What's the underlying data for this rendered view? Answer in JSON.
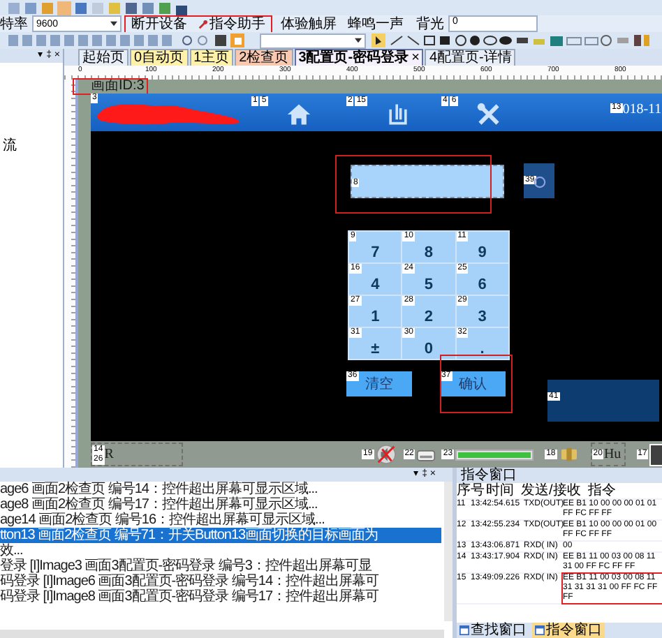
{
  "toolbar": {
    "baud_label": "特率",
    "baud": "9600",
    "groups": [
      {
        "annotated": true,
        "buttons": [
          {
            "label": "断开设备",
            "kind": "plain"
          },
          {
            "label": "指令助手",
            "kind": "tool"
          }
        ]
      },
      {
        "annotated": false,
        "buttons": [
          {
            "label": "体验触屏",
            "kind": "plain"
          },
          {
            "label": "蜂鸣一声",
            "kind": "plain"
          }
        ]
      }
    ],
    "backlight_label": "背光",
    "backlight": "0"
  },
  "side_panel": {
    "controls": "▾ ‡ ×",
    "item": "流"
  },
  "editor": {
    "tabs": [
      {
        "label": "起始页",
        "selected": false,
        "color": "#e8eef8"
      },
      {
        "label": "0自动页",
        "selected": false,
        "color": "#fff2a8"
      },
      {
        "label": "1主页",
        "selected": false,
        "color": "#fff2a8"
      },
      {
        "label": "2检查页",
        "selected": false,
        "color": "#f8c8b0"
      },
      {
        "label": "3配置页-密码登录",
        "selected": true,
        "color": "#f4f0fc",
        "close": "×"
      },
      {
        "label": "4配置页-详情",
        "selected": false,
        "color": "#e8eef8"
      }
    ],
    "ruler": [
      "0",
      "100",
      "200",
      "300",
      "400",
      "500",
      "600",
      "700",
      "800"
    ],
    "screen": {
      "id_label": "画面ID:3",
      "annotated": true,
      "header": {
        "logo_id": "3",
        "nav": [
          {
            "ids": [
              "1",
              "5"
            ],
            "kind": "home"
          },
          {
            "ids": [
              "2",
              "15"
            ],
            "kind": "tower"
          },
          {
            "ids": [
              "4",
              "6"
            ],
            "kind": "tools"
          }
        ],
        "clock_id": "13",
        "clock": "018-11"
      },
      "input": {
        "id": "8",
        "annotated": true
      },
      "icon_tile": {
        "id": "39"
      },
      "keypad": [
        {
          "id": "9",
          "label": "7"
        },
        {
          "id": "10",
          "label": "8"
        },
        {
          "id": "11",
          "label": "9"
        },
        {
          "id": "16",
          "label": "4"
        },
        {
          "id": "24",
          "label": "5"
        },
        {
          "id": "25",
          "label": "6"
        },
        {
          "id": "27",
          "label": "1"
        },
        {
          "id": "28",
          "label": "2"
        },
        {
          "id": "29",
          "label": "3"
        },
        {
          "id": "31",
          "label": "±"
        },
        {
          "id": "30",
          "label": "0"
        },
        {
          "id": "32",
          "label": "."
        }
      ],
      "buttons": [
        {
          "id": "36",
          "label": "清空",
          "annotated": false
        },
        {
          "id": "37",
          "label": "确认",
          "annotated": true
        }
      ],
      "panel": {
        "id": "41"
      },
      "strip": [
        {
          "kind": "text",
          "ids": [
            "14",
            "26"
          ],
          "text": "R"
        },
        {
          "kind": "mute",
          "ids": [
            "19"
          ]
        },
        {
          "kind": "disk",
          "ids": [
            "22"
          ]
        },
        {
          "kind": "bar",
          "ids": [
            "23"
          ],
          "level": 1
        },
        {
          "kind": "plug",
          "ids": [
            "18"
          ]
        },
        {
          "kind": "text",
          "ids": [
            "20"
          ],
          "text": "Hu"
        },
        {
          "kind": "box",
          "ids": [
            "17"
          ]
        }
      ]
    }
  },
  "output_panel": {
    "controls": "▾ ‡ ×",
    "lines": [
      {
        "text": "age6 画面2检查页 编号14：控件超出屏幕可显示区域...",
        "selected": false
      },
      {
        "text": "age8 画面2检查页 编号17：控件超出屏幕可显示区域...",
        "selected": false
      },
      {
        "text": "age14 画面2检查页 编号16：控件超出屏幕可显示区域...",
        "selected": false
      },
      {
        "text": "tton13 画面2检查页 编号71：开关Button13画面切换的目标画面为",
        "selected": true
      },
      {
        "text": "效...",
        "selected": false
      },
      {
        "text": "登录 [I]Image3 画面3配置页-密码登录 编号3：控件超出屏幕可显",
        "selected": false
      },
      {
        "text": "码登录 [I]Image6 画面3配置页-密码登录 编号14：控件超出屏幕可",
        "selected": false
      },
      {
        "text": "码登录 [I]Image8 画面3配置页-密码登录 编号17：控件超出屏幕可",
        "selected": false
      }
    ]
  },
  "command_window": {
    "title": "指令窗口",
    "columns": [
      "序号",
      "时间",
      "发送/接收",
      "指令"
    ],
    "rows": [
      {
        "cells": [
          "11",
          "13:42:54.615",
          "TXD(OUT)",
          "EE B1 10 00 00 00 01 01 FF FC FF FF"
        ],
        "annotated": false
      },
      {
        "cells": [
          "12",
          "13:42:55.234",
          "TXD(OUT)",
          "EE B1 10 00 00 00 01 00 FF FC FF FF"
        ],
        "annotated": false
      },
      {
        "cells": [
          "13",
          "13:43:06.871",
          "RXD( IN)",
          "00"
        ],
        "annotated": false
      },
      {
        "cells": [
          "14",
          "13:43:17.904",
          "RXD( IN)",
          "EE B1 11 00 03 00 08 11 31 00 FF FC FF FF"
        ],
        "annotated": false
      },
      {
        "cells": [
          "15",
          "13:49:09.226",
          "RXD( IN)",
          "EE B1 11 00 03 00 08 11 31 31 31 31 00 FF FC FF FF"
        ],
        "annotated": true
      }
    ],
    "tabs": [
      {
        "label": "查找窗口",
        "selected": false
      },
      {
        "label": "指令窗口",
        "selected": true
      }
    ]
  }
}
